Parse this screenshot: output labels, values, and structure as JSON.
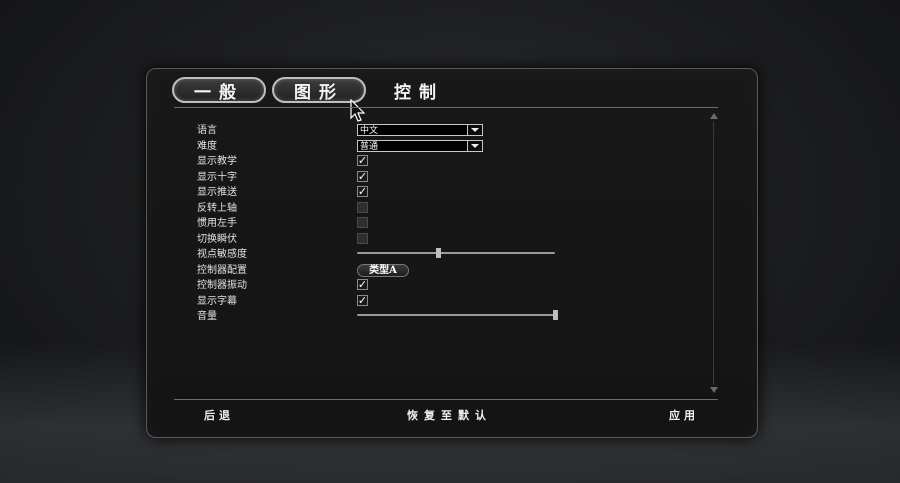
{
  "tabs": [
    {
      "label": "一般",
      "style": "outlined"
    },
    {
      "label": "图形",
      "style": "outlined"
    },
    {
      "label": "控制",
      "style": "plain",
      "active": true
    }
  ],
  "settings": [
    {
      "label": "语言",
      "type": "dropdown",
      "value": "中文"
    },
    {
      "label": "难度",
      "type": "dropdown",
      "value": "普通"
    },
    {
      "label": "显示教学",
      "type": "checkbox",
      "checked": true
    },
    {
      "label": "显示十字",
      "type": "checkbox",
      "checked": true
    },
    {
      "label": "显示推送",
      "type": "checkbox",
      "checked": true
    },
    {
      "label": "反转上轴",
      "type": "checkbox",
      "checked": false
    },
    {
      "label": "惯用左手",
      "type": "checkbox",
      "checked": false
    },
    {
      "label": "切换瞬伏",
      "type": "checkbox",
      "checked": false
    },
    {
      "label": "视点敏感度",
      "type": "slider",
      "value": 0.41
    },
    {
      "label": "控制器配置",
      "type": "button",
      "value": "类型A"
    },
    {
      "label": "控制器振动",
      "type": "checkbox",
      "checked": true
    },
    {
      "label": "显示字幕",
      "type": "checkbox",
      "checked": true
    },
    {
      "label": "音量",
      "type": "slider",
      "value": 1.0
    }
  ],
  "footer": {
    "back": "后退",
    "reset": "恢复至默认",
    "apply": "应用"
  },
  "icons": {
    "check": "✓",
    "cursor": "mouse-pointer-icon",
    "dropdown": "chevron-down-icon"
  },
  "colors": {
    "panel_bg": "#161616",
    "border": "#5a5a5a",
    "text": "#e8e8e8"
  }
}
